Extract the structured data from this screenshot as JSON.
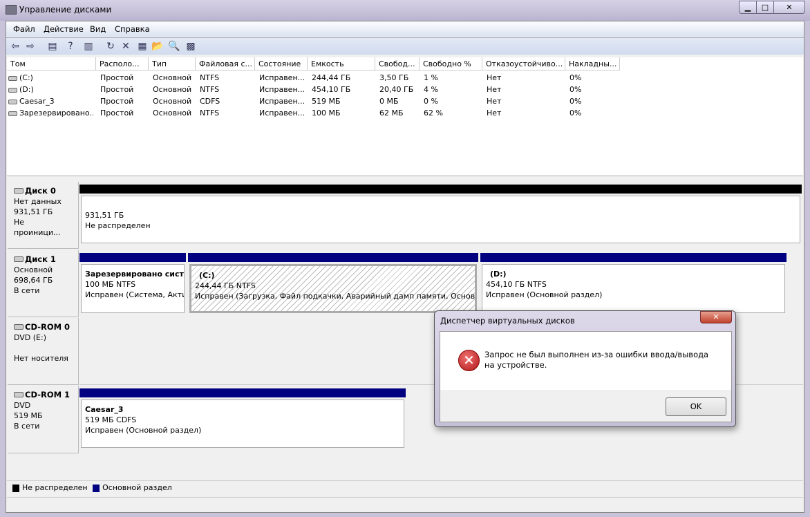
{
  "window": {
    "title": "Управление дисками",
    "minimize": "▁",
    "maximize": "□",
    "close": "✕"
  },
  "menu": [
    "Файл",
    "Действие",
    "Вид",
    "Справка"
  ],
  "toolbar": [
    {
      "icon": "back-icon",
      "glyph": "⇦"
    },
    {
      "icon": "forward-icon",
      "glyph": "⇨"
    },
    {
      "icon": "console-tree-icon",
      "glyph": "▤"
    },
    {
      "icon": "help-icon",
      "glyph": "?"
    },
    {
      "icon": "action-pane-icon",
      "glyph": "▥"
    },
    {
      "icon": "refresh-icon",
      "glyph": "↻"
    },
    {
      "icon": "delete-icon",
      "glyph": "✕"
    },
    {
      "icon": "properties-icon",
      "glyph": "▦"
    },
    {
      "icon": "open-folder-icon",
      "glyph": "📂"
    },
    {
      "icon": "search-icon",
      "glyph": "🔍"
    },
    {
      "icon": "settings-icon",
      "glyph": "▩"
    }
  ],
  "volumes": {
    "columns": [
      "Том",
      "Располо...",
      "Тип",
      "Файловая с...",
      "Состояние",
      "Емкость",
      "Свобод...",
      "Свободно %",
      "Отказоустойчиво...",
      "Накладны..."
    ],
    "rows": [
      [
        "(C:)",
        "Простой",
        "Основной",
        "NTFS",
        "Исправен...",
        "244,44 ГБ",
        "3,50 ГБ",
        "1 %",
        "Нет",
        "0%"
      ],
      [
        "(D:)",
        "Простой",
        "Основной",
        "NTFS",
        "Исправен...",
        "454,10 ГБ",
        "20,40 ГБ",
        "4 %",
        "Нет",
        "0%"
      ],
      [
        "Caesar_3",
        "Простой",
        "Основной",
        "CDFS",
        "Исправен...",
        "519 МБ",
        "0 МБ",
        "0 %",
        "Нет",
        "0%"
      ],
      [
        "Зарезервировано...",
        "Простой",
        "Основной",
        "NTFS",
        "Исправен...",
        "100 МБ",
        "62 МБ",
        "62 %",
        "Нет",
        "0%"
      ]
    ]
  },
  "disks": [
    {
      "name": "Диск 0",
      "lines": [
        "Нет данных",
        "931,51 ГБ",
        "Не проиници..."
      ],
      "partitions": [
        {
          "title": "",
          "line1": "931,51 ГБ",
          "line2": "Не распределен",
          "type": "unallocated"
        }
      ]
    },
    {
      "name": "Диск 1",
      "lines": [
        "Основной",
        "698,64 ГБ",
        "В сети"
      ],
      "partitions": [
        {
          "title": "Зарезервировано систем",
          "line1": "100 МБ NTFS",
          "line2": "Исправен (Система, Активен, Основной раздел)",
          "type": "primary"
        },
        {
          "title": "(C:)",
          "line1": "244,44 ГБ NTFS",
          "line2": "Исправен (Загрузка, Файл подкачки, Аварийный дамп памяти, Основной раздел)",
          "type": "primary",
          "selected": true
        },
        {
          "title": "(D:)",
          "line1": "454,10 ГБ NTFS",
          "line2": "Исправен (Основной раздел)",
          "type": "primary"
        }
      ]
    },
    {
      "name": "CD-ROM 0",
      "lines": [
        "DVD (E:)",
        "",
        "Нет носителя"
      ],
      "partitions": []
    },
    {
      "name": "CD-ROM 1",
      "lines": [
        "DVD",
        "519 МБ",
        "В сети"
      ],
      "partitions": [
        {
          "title": "Caesar_3",
          "line1": "519 МБ CDFS",
          "line2": "Исправен (Основной раздел)",
          "type": "primary"
        }
      ]
    }
  ],
  "legend": [
    {
      "label": "Не распределен",
      "color": "#000000"
    },
    {
      "label": "Основной раздел",
      "color": "#000080"
    }
  ],
  "dialog": {
    "title": "Диспетчер виртуальных дисков",
    "close": "✕",
    "icon": "error-icon",
    "message": "Запрос не был выполнен из-за ошибки ввода/вывода на устройстве.",
    "ok": "OK"
  }
}
